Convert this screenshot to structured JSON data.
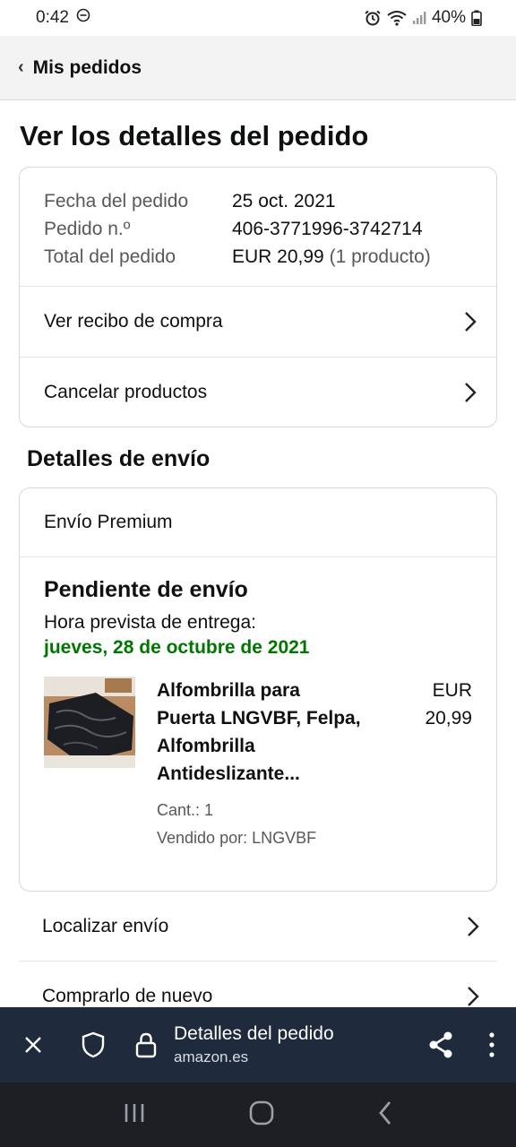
{
  "status_bar": {
    "time": "0:42",
    "battery": "40%"
  },
  "nav": {
    "back_label": "Mis pedidos"
  },
  "page": {
    "title": "Ver los detalles del pedido"
  },
  "order_summary": {
    "rows": [
      {
        "label": "Fecha del pedido",
        "value": "25 oct. 2021",
        "extra": ""
      },
      {
        "label": "Pedido n.º",
        "value": "406-3771996-3742714",
        "extra": ""
      },
      {
        "label": "Total del pedido",
        "value": "EUR 20,99",
        "extra": "(1 producto)"
      }
    ],
    "links": [
      "Ver recibo de compra",
      "Cancelar productos"
    ]
  },
  "shipping": {
    "section_title": "Detalles de envío",
    "type": "Envío Premium",
    "status": "Pendiente de envío",
    "eta_label": "Hora prevista de entrega:",
    "eta_date": "jueves, 28 de octubre de 2021",
    "product": {
      "title": "Alfombrilla para Puerta LNGVBF, Felpa, Alfombrilla Antideslizante...",
      "qty": "Cant.: 1",
      "seller": "Vendido por: LNGVBF",
      "price_currency": "EUR",
      "price_value": "20,99"
    }
  },
  "actions": [
    "Localizar envío",
    "Comprarlo de nuevo"
  ],
  "browser": {
    "title": "Detalles del pedido",
    "url": "amazon.es"
  },
  "colors": {
    "eta_green": "#007600",
    "browser_bar": "#1f2a3c"
  }
}
